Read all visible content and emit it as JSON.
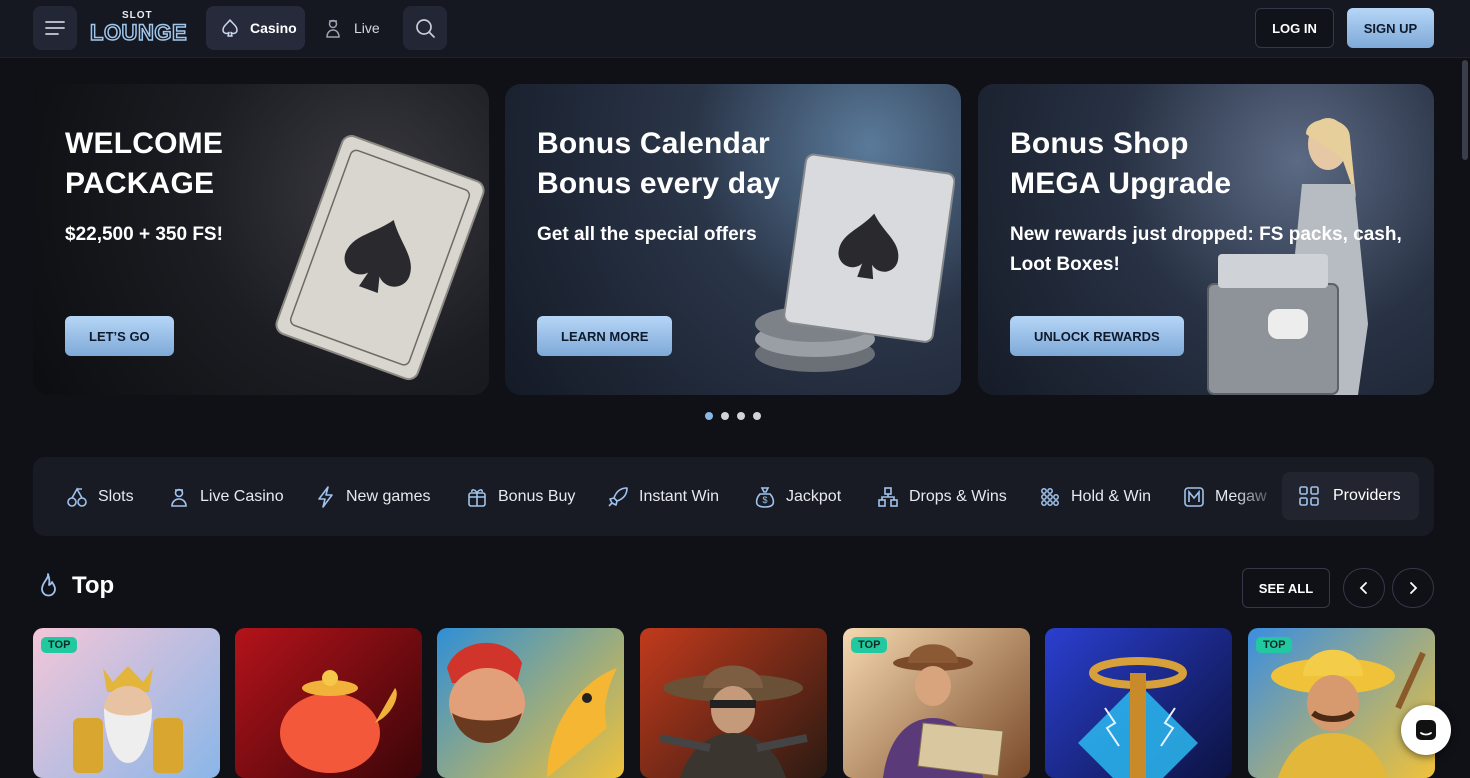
{
  "header": {
    "logo_small": "SLOT",
    "logo_big": "LOUNGE",
    "nav": [
      {
        "label": "Casino",
        "icon": "spade-icon",
        "active": true
      },
      {
        "label": "Live",
        "icon": "dealer-icon",
        "active": false
      }
    ],
    "login_label": "LOG IN",
    "signup_label": "SIGN UP"
  },
  "banners": [
    {
      "title_line1": "WELCOME",
      "title_line2": "PACKAGE",
      "subtitle": "$22,500 + 350 FS!",
      "button": "LET’S GO"
    },
    {
      "title_line1": "Bonus Calendar",
      "title_line2": "Bonus every day",
      "subtitle": "Get all the special offers",
      "button": "LEARN MORE"
    },
    {
      "title_line1": "Bonus Shop",
      "title_line2": "MEGA Upgrade",
      "subtitle": "New rewards just dropped: FS packs, cash, Loot Boxes!",
      "button": "UNLOCK REWARDS"
    }
  ],
  "carousel": {
    "dots": 4,
    "active_index": 0
  },
  "categories": [
    {
      "label": "Slots",
      "icon": "cherries-icon"
    },
    {
      "label": "Live Casino",
      "icon": "dealer-icon"
    },
    {
      "label": "New games",
      "icon": "lightning-icon"
    },
    {
      "label": "Bonus Buy",
      "icon": "gift-icon"
    },
    {
      "label": "Instant Win",
      "icon": "rocket-icon"
    },
    {
      "label": "Jackpot",
      "icon": "money-bag-icon"
    },
    {
      "label": "Drops & Wins",
      "icon": "pyramid-icon"
    },
    {
      "label": "Hold & Win",
      "icon": "dots-grid-icon"
    },
    {
      "label": "Megaw",
      "icon": "megaways-icon"
    }
  ],
  "providers_label": "Providers",
  "section": {
    "title": "Top",
    "see_all": "SEE ALL"
  },
  "games": [
    {
      "badge": "TOP",
      "colors": [
        "#f3c6d8",
        "#8ab6e8"
      ]
    },
    {
      "badge": "",
      "colors": [
        "#b4131a",
        "#3a0508"
      ]
    },
    {
      "badge": "",
      "colors": [
        "#2f8fd6",
        "#f0c23a"
      ]
    },
    {
      "badge": "",
      "colors": [
        "#c23a1c",
        "#2a1a12"
      ]
    },
    {
      "badge": "TOP",
      "colors": [
        "#f5d9b0",
        "#7a4a2a"
      ]
    },
    {
      "badge": "",
      "colors": [
        "#2a3fd0",
        "#0c1240"
      ]
    },
    {
      "badge": "TOP",
      "colors": [
        "#3a8ee0",
        "#f0c23a"
      ]
    }
  ]
}
